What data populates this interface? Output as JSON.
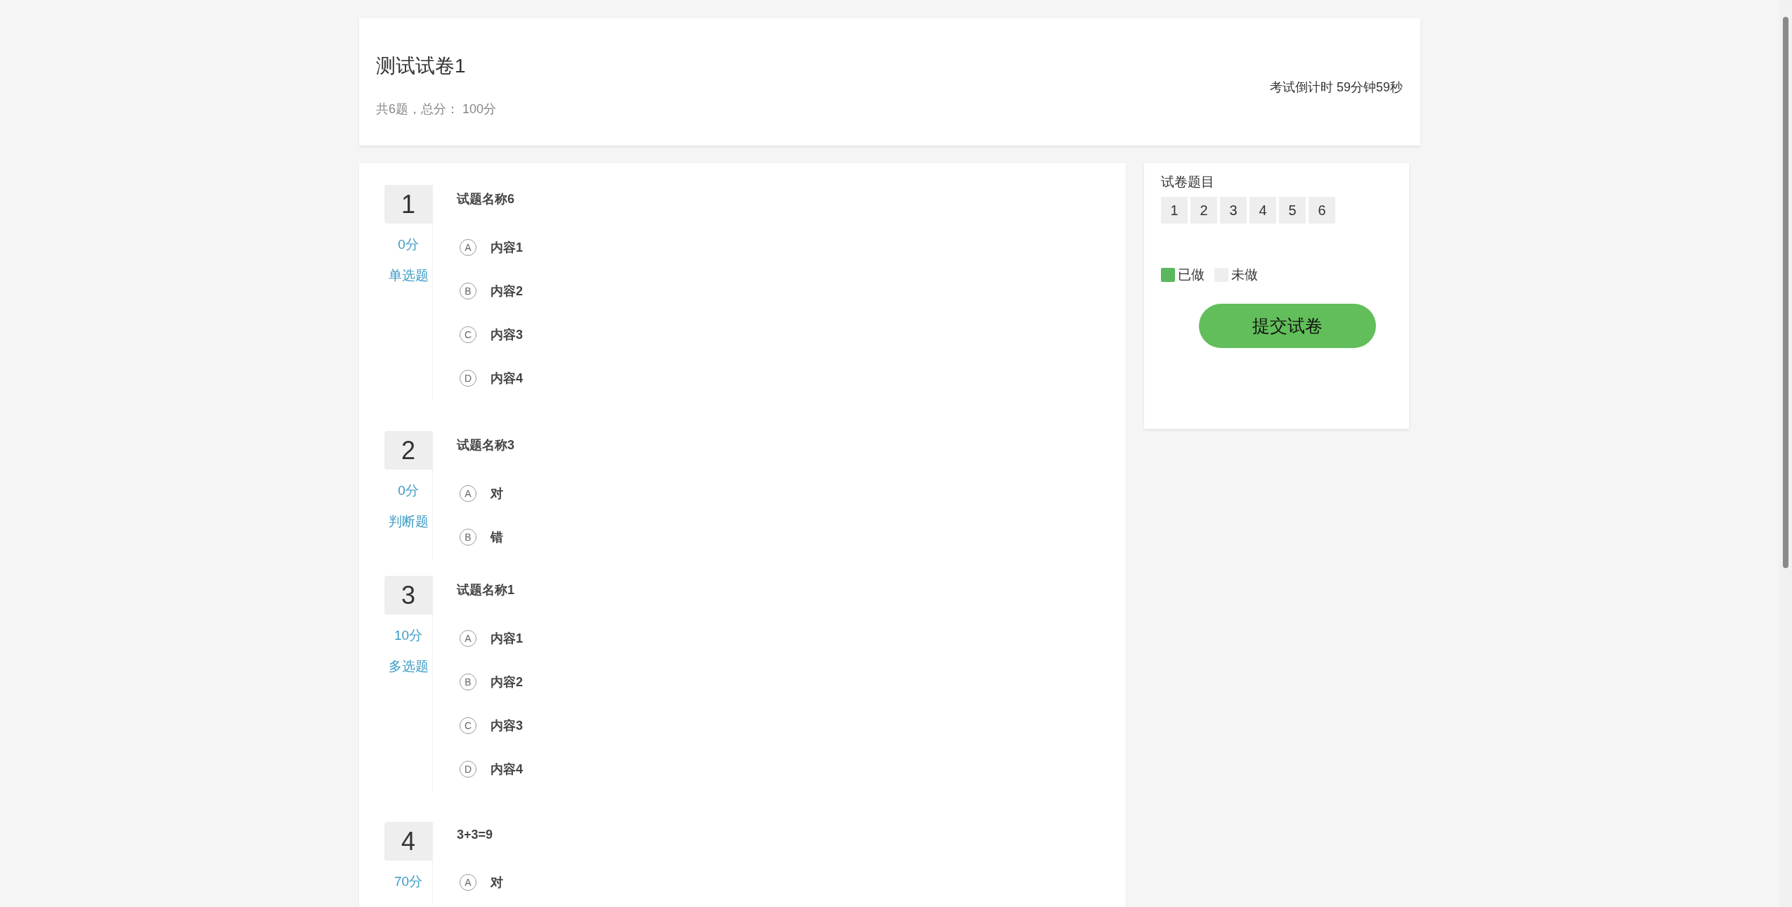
{
  "header": {
    "title": "测试试卷1",
    "summary": "共6题，总分： 100分",
    "timer": "考试倒计时 59分钟59秒"
  },
  "questions": [
    {
      "number": "1",
      "score": "0分",
      "type": "单选题",
      "title": "试题名称6",
      "options": [
        {
          "letter": "A",
          "text": "内容1"
        },
        {
          "letter": "B",
          "text": "内容2"
        },
        {
          "letter": "C",
          "text": "内容3"
        },
        {
          "letter": "D",
          "text": "内容4"
        }
      ]
    },
    {
      "number": "2",
      "score": "0分",
      "type": "判断题",
      "title": "试题名称3",
      "options": [
        {
          "letter": "A",
          "text": "对"
        },
        {
          "letter": "B",
          "text": "错"
        }
      ]
    },
    {
      "number": "3",
      "score": "10分",
      "type": "多选题",
      "title": "试题名称1",
      "options": [
        {
          "letter": "A",
          "text": "内容1"
        },
        {
          "letter": "B",
          "text": "内容2"
        },
        {
          "letter": "C",
          "text": "内容3"
        },
        {
          "letter": "D",
          "text": "内容4"
        }
      ]
    },
    {
      "number": "4",
      "score": "70分",
      "title": "3+3=9",
      "options": [
        {
          "letter": "A",
          "text": "对"
        }
      ]
    }
  ],
  "navigator": {
    "title": "试卷题目",
    "items": [
      {
        "label": "1",
        "done": false
      },
      {
        "label": "2",
        "done": false
      },
      {
        "label": "3",
        "done": false
      },
      {
        "label": "4",
        "done": false
      },
      {
        "label": "5",
        "done": false
      },
      {
        "label": "6",
        "done": false
      }
    ],
    "legend": [
      {
        "label": "已做",
        "color": "#5cb85c"
      },
      {
        "label": "未做",
        "color": "#eeeeee"
      }
    ],
    "submit": "提交试卷"
  }
}
